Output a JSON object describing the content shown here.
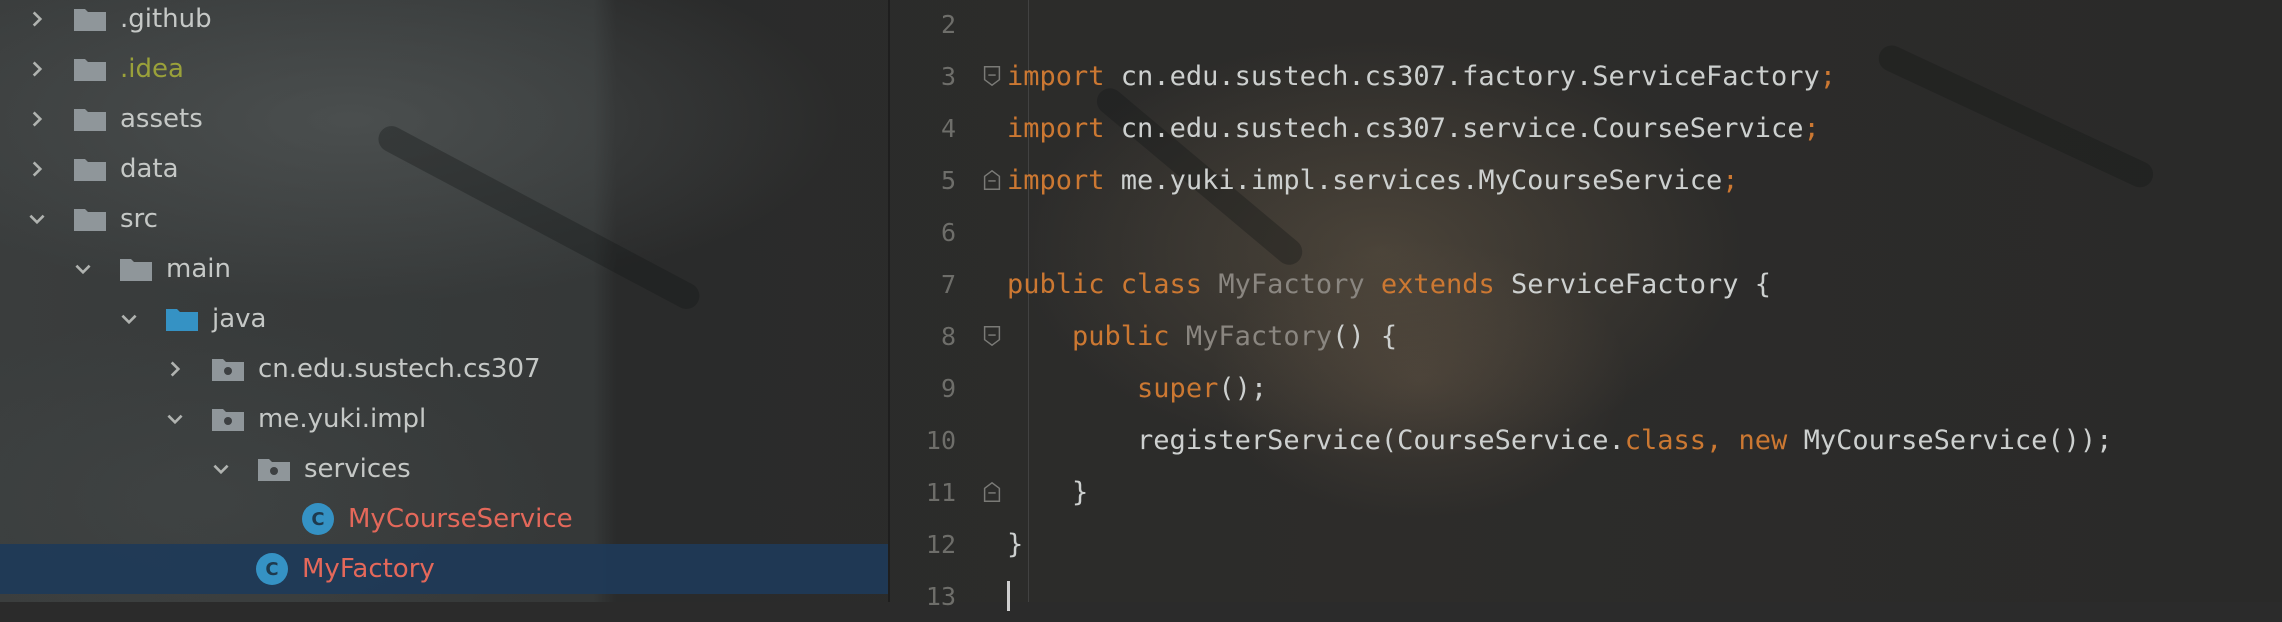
{
  "tree": {
    "items": [
      {
        "label": ".github",
        "icon": "folder-icon",
        "expanded": false
      },
      {
        "label": ".idea",
        "icon": "folder-icon",
        "expanded": false
      },
      {
        "label": "assets",
        "icon": "folder-icon",
        "expanded": false
      },
      {
        "label": "data",
        "icon": "folder-icon",
        "expanded": false
      },
      {
        "label": "src",
        "icon": "folder-icon",
        "expanded": true
      },
      {
        "label": "main",
        "icon": "folder-icon",
        "expanded": true
      },
      {
        "label": "java",
        "icon": "source-folder-icon",
        "expanded": true
      },
      {
        "label": "cn.edu.sustech.cs307",
        "icon": "package-icon",
        "expanded": false
      },
      {
        "label": "me.yuki.impl",
        "icon": "package-icon",
        "expanded": true
      },
      {
        "label": "services",
        "icon": "package-icon",
        "expanded": true
      },
      {
        "label": "MyCourseService",
        "icon": "class-icon"
      },
      {
        "label": "MyFactory",
        "icon": "class-icon",
        "selected": true
      }
    ],
    "class_badge": "C"
  },
  "editor": {
    "line_numbers": [
      "2",
      "3",
      "4",
      "5",
      "6",
      "7",
      "8",
      "9",
      "10",
      "11",
      "12",
      "13"
    ],
    "lines": {
      "l3": {
        "kw": "import",
        "text": " cn.edu.sustech.cs307.factory.ServiceFactory",
        "semi": ";"
      },
      "l4": {
        "kw": "import",
        "text": " cn.edu.sustech.cs307.service.CourseService",
        "semi": ";"
      },
      "l5": {
        "kw": "import",
        "text": " me.yuki.impl.services.MyCourseService",
        "semi": ";"
      },
      "l7": {
        "kw1": "public class",
        "name": "MyFactory",
        "kw2": "extends",
        "rest": " ServiceFactory {"
      },
      "l8": {
        "kw": "public",
        "name": "MyFactory",
        "rest": "() {"
      },
      "l9": {
        "kw": "super",
        "rest": "();"
      },
      "l10": {
        "a": "registerService(CourseService.",
        "kw1": "class",
        "comma": ",",
        "kw2": "new",
        "b": " MyCourseService());"
      },
      "l11": {
        "text": "}"
      },
      "l12": {
        "text": "}"
      }
    }
  },
  "colors": {
    "keyword": "#cc7832",
    "selection": "#1e3a58",
    "class_icon": "#3592c4",
    "class_label": "#e4685a",
    "idea_label": "#9aa13a"
  }
}
